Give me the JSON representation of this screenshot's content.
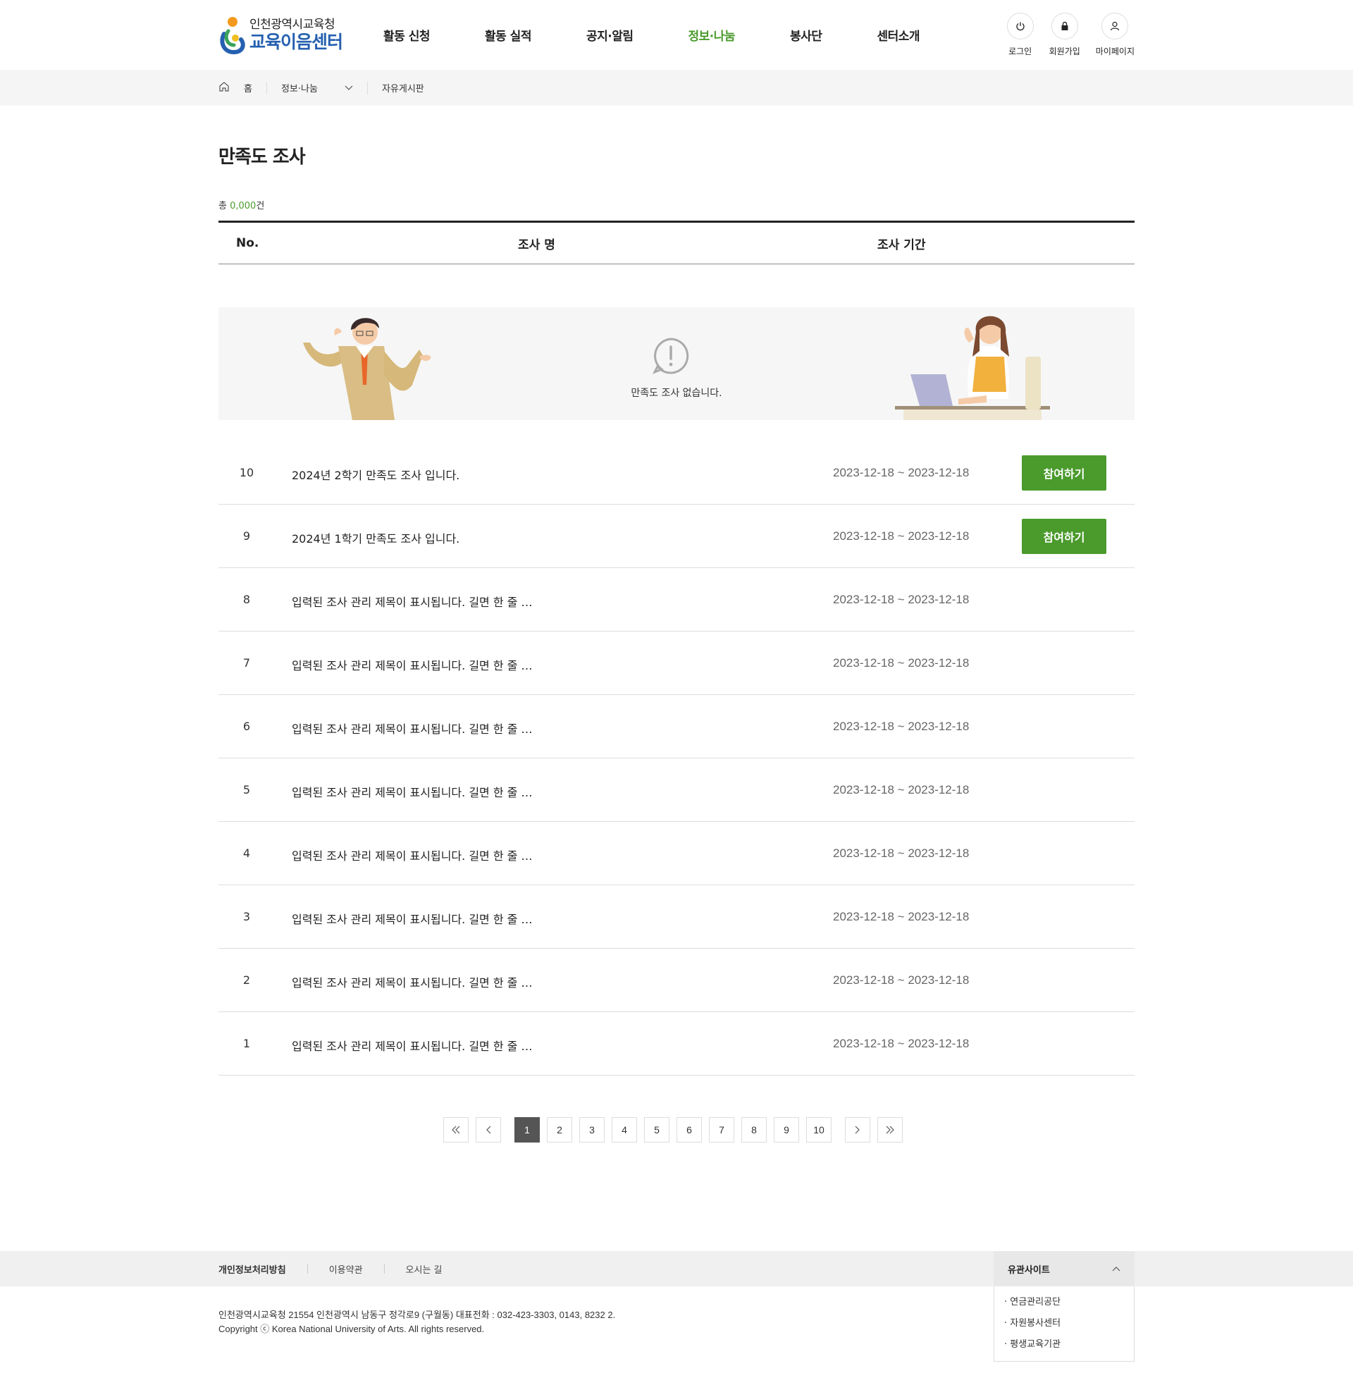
{
  "header": {
    "logo_small": "인천광역시교육청",
    "logo_big": "교육이음센터",
    "nav": [
      "활동 신청",
      "활동 실적",
      "공지·알림",
      "정보·나눔",
      "봉사단",
      "센터소개"
    ],
    "active_index": 3,
    "util": [
      {
        "label": "로그인",
        "icon": "power-icon"
      },
      {
        "label": "회원가입",
        "icon": "lock-icon"
      },
      {
        "label": "마이페이지",
        "icon": "user-icon"
      }
    ]
  },
  "breadcrumb": {
    "home": "홈",
    "section": "정보·나눔",
    "current": "자유게시판"
  },
  "page": {
    "title": "만족도 조사",
    "total_prefix": "총 ",
    "total_num": "0,000",
    "total_suffix": "건"
  },
  "table": {
    "headers": {
      "no": "No.",
      "name": "조사 명",
      "period": "조사 기간"
    },
    "empty_message": "만족도 조사 없습니다.",
    "rows": [
      {
        "no": "10",
        "title": "2024년 2학기 만족도 조사 입니다.",
        "period": "2023-12-18 ~ 2023-12-18",
        "button": "참여하기"
      },
      {
        "no": "9",
        "title": "2024년 1학기 만족도 조사 입니다.",
        "period": "2023-12-18 ~ 2023-12-18",
        "button": "참여하기"
      },
      {
        "no": "8",
        "title": "입력된 조사 관리 제목이 표시됩니다. 길면 한 줄 …",
        "period": "2023-12-18 ~ 2023-12-18",
        "button": ""
      },
      {
        "no": "7",
        "title": "입력된 조사 관리 제목이 표시됩니다. 길면 한 줄 …",
        "period": "2023-12-18 ~ 2023-12-18",
        "button": ""
      },
      {
        "no": "6",
        "title": "입력된 조사 관리 제목이 표시됩니다. 길면 한 줄 …",
        "period": "2023-12-18 ~ 2023-12-18",
        "button": ""
      },
      {
        "no": "5",
        "title": "입력된 조사 관리 제목이 표시됩니다. 길면 한 줄 …",
        "period": "2023-12-18 ~ 2023-12-18",
        "button": ""
      },
      {
        "no": "4",
        "title": "입력된 조사 관리 제목이 표시됩니다. 길면 한 줄 …",
        "period": "2023-12-18 ~ 2023-12-18",
        "button": ""
      },
      {
        "no": "3",
        "title": "입력된 조사 관리 제목이 표시됩니다. 길면 한 줄 …",
        "period": "2023-12-18 ~ 2023-12-18",
        "button": ""
      },
      {
        "no": "2",
        "title": "입력된 조사 관리 제목이 표시됩니다. 길면 한 줄 …",
        "period": "2023-12-18 ~ 2023-12-18",
        "button": ""
      },
      {
        "no": "1",
        "title": "입력된 조사 관리 제목이 표시됩니다. 길면 한 줄 …",
        "period": "2023-12-18 ~ 2023-12-18",
        "button": ""
      }
    ]
  },
  "pagination": {
    "pages": [
      "1",
      "2",
      "3",
      "4",
      "5",
      "6",
      "7",
      "8",
      "9",
      "10"
    ],
    "current": "1"
  },
  "footer": {
    "links": [
      "개인정보처리방침",
      "이용약관",
      "오시는 길"
    ],
    "family_title": "유관사이트",
    "family_sites": [
      "· 연금관리공단",
      "· 자원봉사센터",
      "· 평생교육기관"
    ],
    "address": "인천광역시교육청 21554 인천광역시 남동구 정각로9 (구월동) 대표전화 : 032-423-3303, 0143, 8232 2.",
    "copyright": "Copyright ⓒ Korea National University of Arts. All rights reserved."
  },
  "colors": {
    "accent": "#4a9a2c",
    "logo_blue": "#2560b0",
    "active_page": "#555555"
  }
}
